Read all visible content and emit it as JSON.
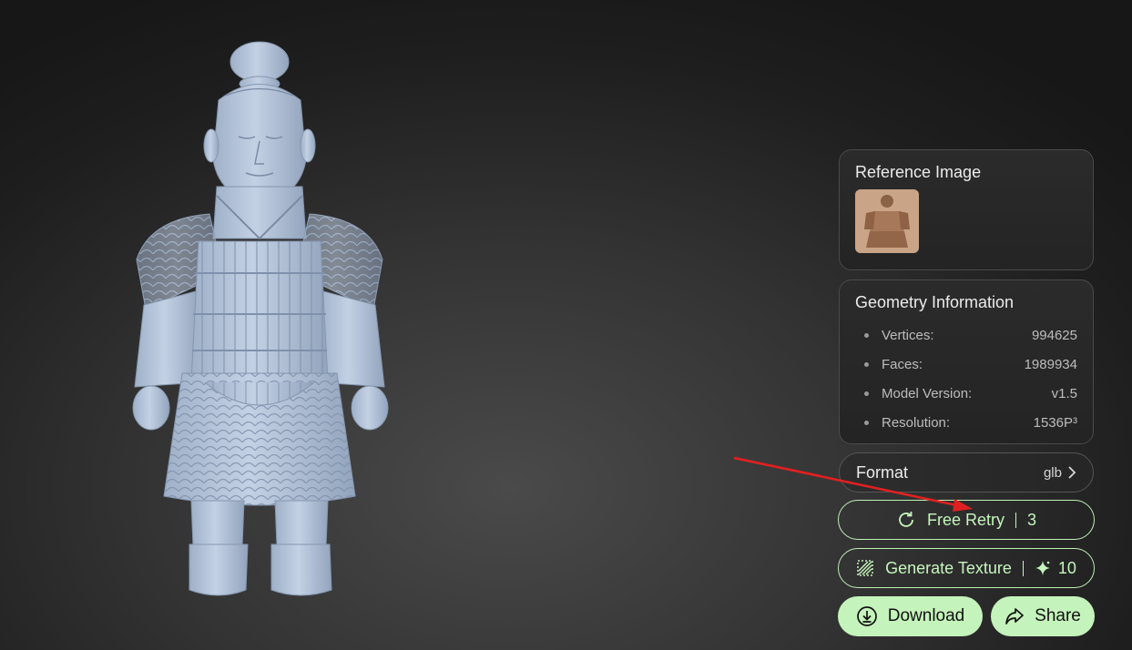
{
  "reference": {
    "title": "Reference Image"
  },
  "geometry": {
    "title": "Geometry Information",
    "items": [
      {
        "label": "Vertices:",
        "value": "994625"
      },
      {
        "label": "Faces:",
        "value": "1989934"
      },
      {
        "label": "Model Version:",
        "value": "v1.5"
      },
      {
        "label": "Resolution:",
        "value": "1536P³"
      }
    ]
  },
  "format": {
    "label": "Format",
    "value": "glb"
  },
  "actions": {
    "free_retry_label": "Free Retry",
    "free_retry_count": "3",
    "generate_texture_label": "Generate Texture",
    "generate_texture_cost": "10",
    "download_label": "Download",
    "share_label": "Share"
  },
  "icons": {
    "retry": "refresh-icon",
    "texture": "hatch-icon",
    "credits": "sparkle-icon",
    "download": "download-icon",
    "share": "share-icon",
    "chevron": "chevron-right-icon"
  },
  "colors": {
    "accent": "#c4f3bb",
    "model": "#aebfd6",
    "annotation_arrow": "#e02020"
  }
}
